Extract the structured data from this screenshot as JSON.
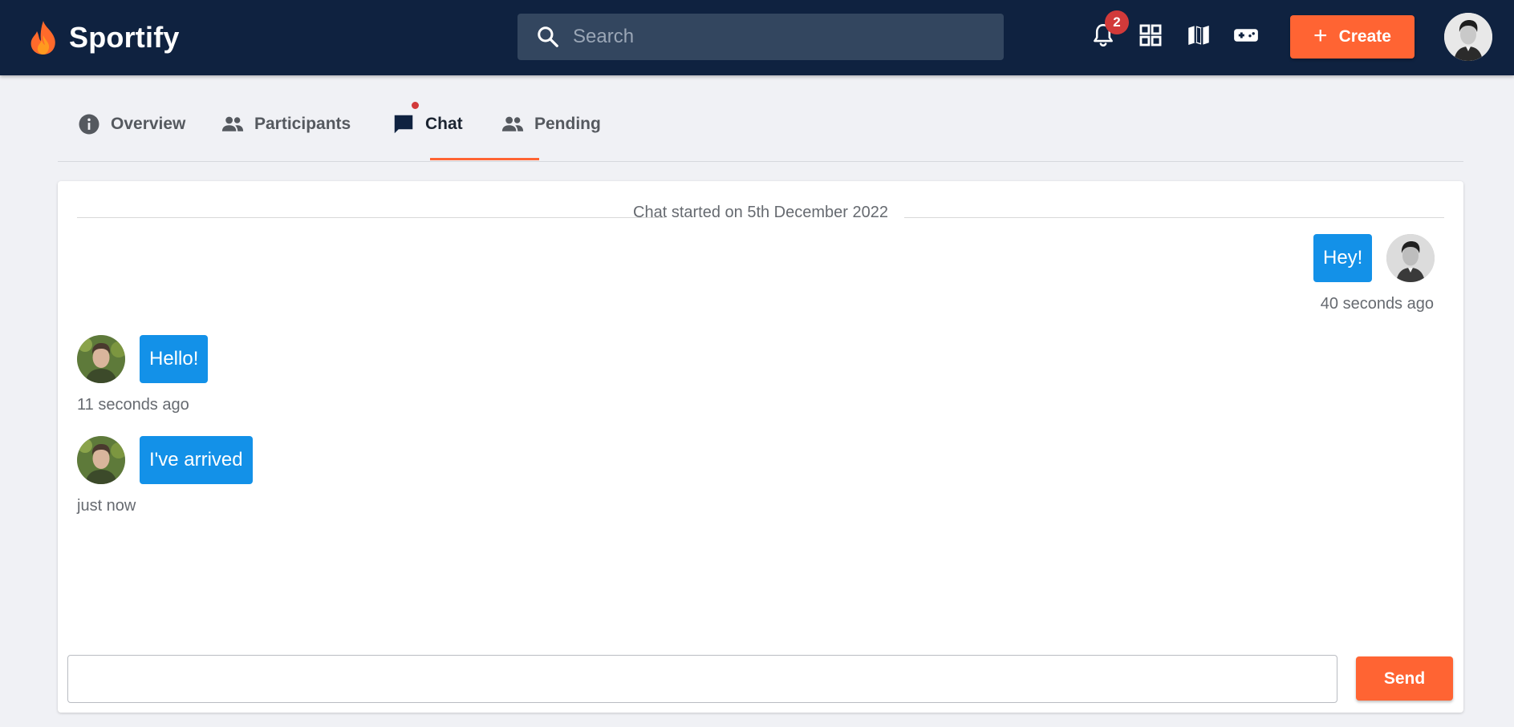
{
  "app": {
    "name": "Sportify"
  },
  "search": {
    "placeholder": "Search"
  },
  "notifications": {
    "count": "2"
  },
  "toolbar": {
    "create_label": "Create"
  },
  "tabs": [
    {
      "label": "Overview",
      "icon": "info-icon"
    },
    {
      "label": "Participants",
      "icon": "people-icon"
    },
    {
      "label": "Chat",
      "icon": "chat-icon",
      "active": true,
      "has_unread": true
    },
    {
      "label": "Pending",
      "icon": "people-icon"
    }
  ],
  "chat": {
    "started_text": "Chat started on 5th December 2022",
    "messages": [
      {
        "text": "Hey!",
        "time": "40 seconds ago",
        "side": "right"
      },
      {
        "text": "Hello!",
        "time": "11 seconds ago",
        "side": "left"
      },
      {
        "text": "I've arrived",
        "time": "just now",
        "side": "left"
      }
    ],
    "input_value": "",
    "send_label": "Send"
  },
  "colors": {
    "navbar": "#0f2240",
    "accent": "#ff6433",
    "bubble": "#1391e8",
    "badge": "#d23a3a"
  }
}
